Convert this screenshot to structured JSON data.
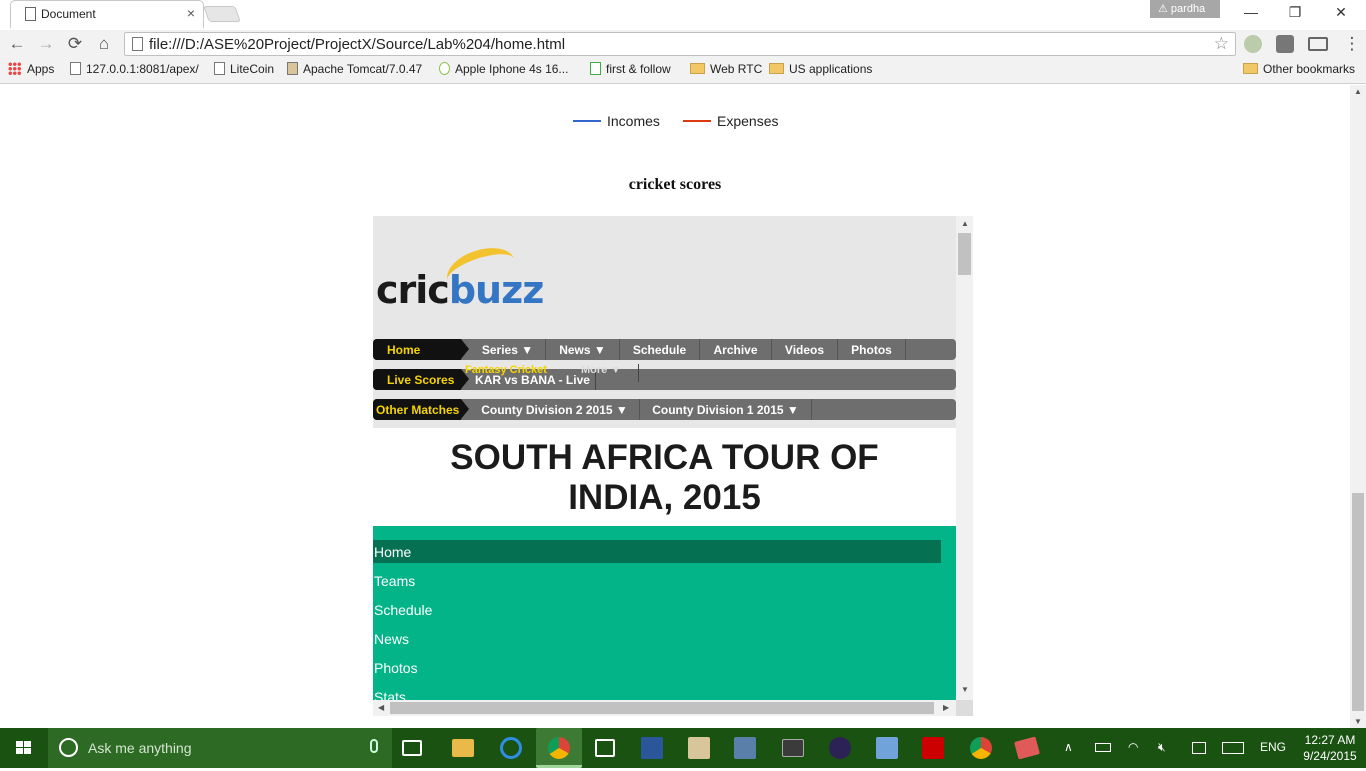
{
  "browser": {
    "tab_title": "Document",
    "tab_close": "×",
    "profile_name": "pardha",
    "url": "file:///D:/ASE%20Project/ProjectX/Source/Lab%204/home.html",
    "window_controls": {
      "minimize": "—",
      "restore": "❐",
      "close": "✕"
    },
    "nav": {
      "back": "←",
      "forward": "→",
      "reload": "⟳",
      "home": "⌂"
    },
    "star": "☆",
    "menu_icon": "⋮"
  },
  "bookmarks": [
    {
      "label": "Apps",
      "icon": "apps-grid-icon"
    },
    {
      "label": "127.0.0.1:8081/apex/",
      "icon": "page-icon"
    },
    {
      "label": "LiteCoin",
      "icon": "page-icon"
    },
    {
      "label": "Apache Tomcat/7.0.47",
      "icon": "tomcat-icon"
    },
    {
      "label": "Apple Iphone 4s 16...",
      "icon": "q-icon"
    },
    {
      "label": "first & follow",
      "icon": "j-icon"
    },
    {
      "label": "Web RTC",
      "icon": "folder-icon"
    },
    {
      "label": "US applications",
      "icon": "folder-icon"
    },
    {
      "label": "Other bookmarks",
      "icon": "folder-icon"
    }
  ],
  "page": {
    "legend": {
      "incomes": {
        "label": "Incomes",
        "color": "#3366cc"
      },
      "expenses": {
        "label": "Expenses",
        "color": "#dc3912"
      }
    },
    "heading": "cricket scores"
  },
  "cricbuzz": {
    "logo_text_1": "cric",
    "logo_text_2": "buzz",
    "nav_main": {
      "lead": "Home",
      "items": [
        "Series ▼",
        "News ▼",
        "Schedule",
        "Archive",
        "Videos",
        "Photos"
      ],
      "overlay_1": "Fantasy Cricket",
      "overlay_2": "More ▼"
    },
    "nav_live": {
      "lead": "Live Scores",
      "items": [
        "KAR vs BANA - Live"
      ]
    },
    "nav_other": {
      "lead": "Other Matches",
      "items": [
        "County Division 2 2015   ▼",
        "County Division 1 2015   ▼"
      ]
    },
    "series_title_line1": "SOUTH AFRICA TOUR OF",
    "series_title_line2": "INDIA, 2015",
    "menu": [
      "Home",
      "Teams",
      "Schedule",
      "News",
      "Photos",
      "Stats"
    ],
    "colors": {
      "menu_bg": "#02b487",
      "menu_active": "#057152",
      "nav_lead_text": "#f5d400"
    }
  },
  "taskbar": {
    "search_placeholder": "Ask me anything",
    "language": "ENG",
    "time": "12:27 AM",
    "date": "9/24/2015",
    "up_arrow": "∧"
  }
}
